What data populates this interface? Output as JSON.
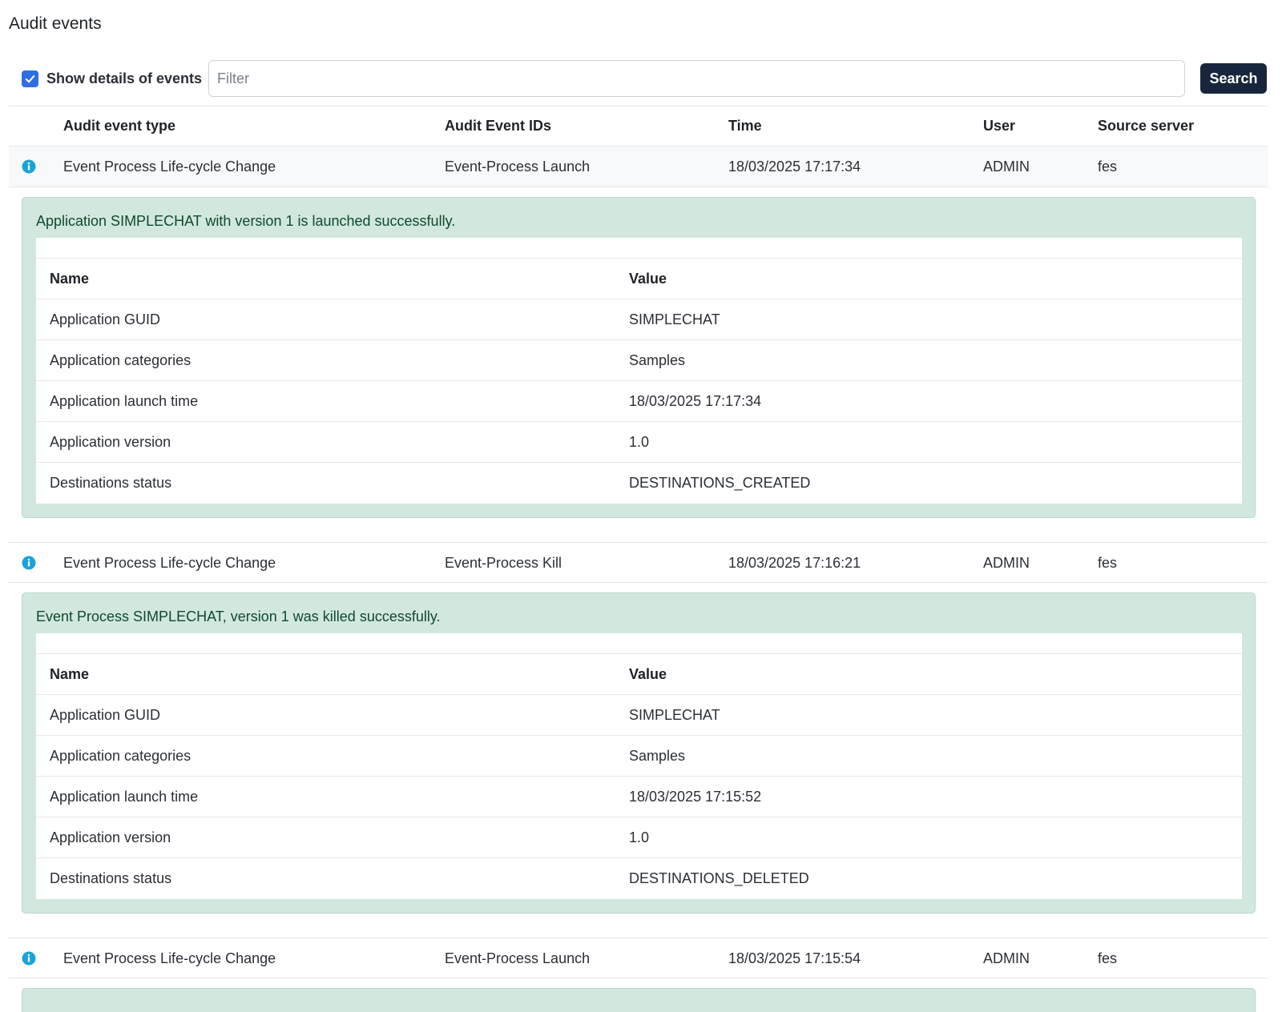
{
  "page": {
    "title": "Audit events"
  },
  "toolbar": {
    "show_details_label": "Show details of events",
    "show_details_checked": true,
    "filter_placeholder": "Filter",
    "filter_value": "",
    "search_label": "Search"
  },
  "columns": {
    "type": "Audit event type",
    "ids": "Audit Event IDs",
    "time": "Time",
    "user": "User",
    "source": "Source server"
  },
  "events": [
    {
      "type": "Event Process Life-cycle Change",
      "ids": "Event-Process Launch",
      "time": "18/03/2025 17:17:34",
      "user": "ADMIN",
      "source": "fes",
      "message": "Application SIMPLECHAT with version 1 is launched successfully.",
      "details_header": {
        "name": "Name",
        "value": "Value"
      },
      "details": [
        {
          "name": "Application GUID",
          "value": "SIMPLECHAT"
        },
        {
          "name": "Application categories",
          "value": "Samples"
        },
        {
          "name": "Application launch time",
          "value": "18/03/2025 17:17:34"
        },
        {
          "name": "Application version",
          "value": "1.0"
        },
        {
          "name": "Destinations status",
          "value": "DESTINATIONS_CREATED"
        }
      ]
    },
    {
      "type": "Event Process Life-cycle Change",
      "ids": "Event-Process Kill",
      "time": "18/03/2025 17:16:21",
      "user": "ADMIN",
      "source": "fes",
      "message": "Event Process SIMPLECHAT, version 1 was killed successfully.",
      "details_header": {
        "name": "Name",
        "value": "Value"
      },
      "details": [
        {
          "name": "Application GUID",
          "value": "SIMPLECHAT"
        },
        {
          "name": "Application categories",
          "value": "Samples"
        },
        {
          "name": "Application launch time",
          "value": "18/03/2025 17:15:52"
        },
        {
          "name": "Application version",
          "value": "1.0"
        },
        {
          "name": "Destinations status",
          "value": "DESTINATIONS_DELETED"
        }
      ]
    },
    {
      "type": "Event Process Life-cycle Change",
      "ids": "Event-Process Launch",
      "time": "18/03/2025 17:15:54",
      "user": "ADMIN",
      "source": "fes"
    }
  ],
  "colors": {
    "accent": "#2f6fe0",
    "button": "#17263d",
    "info": "#1aa3d9",
    "success_bg": "#d2e8df",
    "success_text": "#0f4a2c"
  },
  "icons": {
    "info": "info-icon",
    "check": "checkmark-icon"
  }
}
